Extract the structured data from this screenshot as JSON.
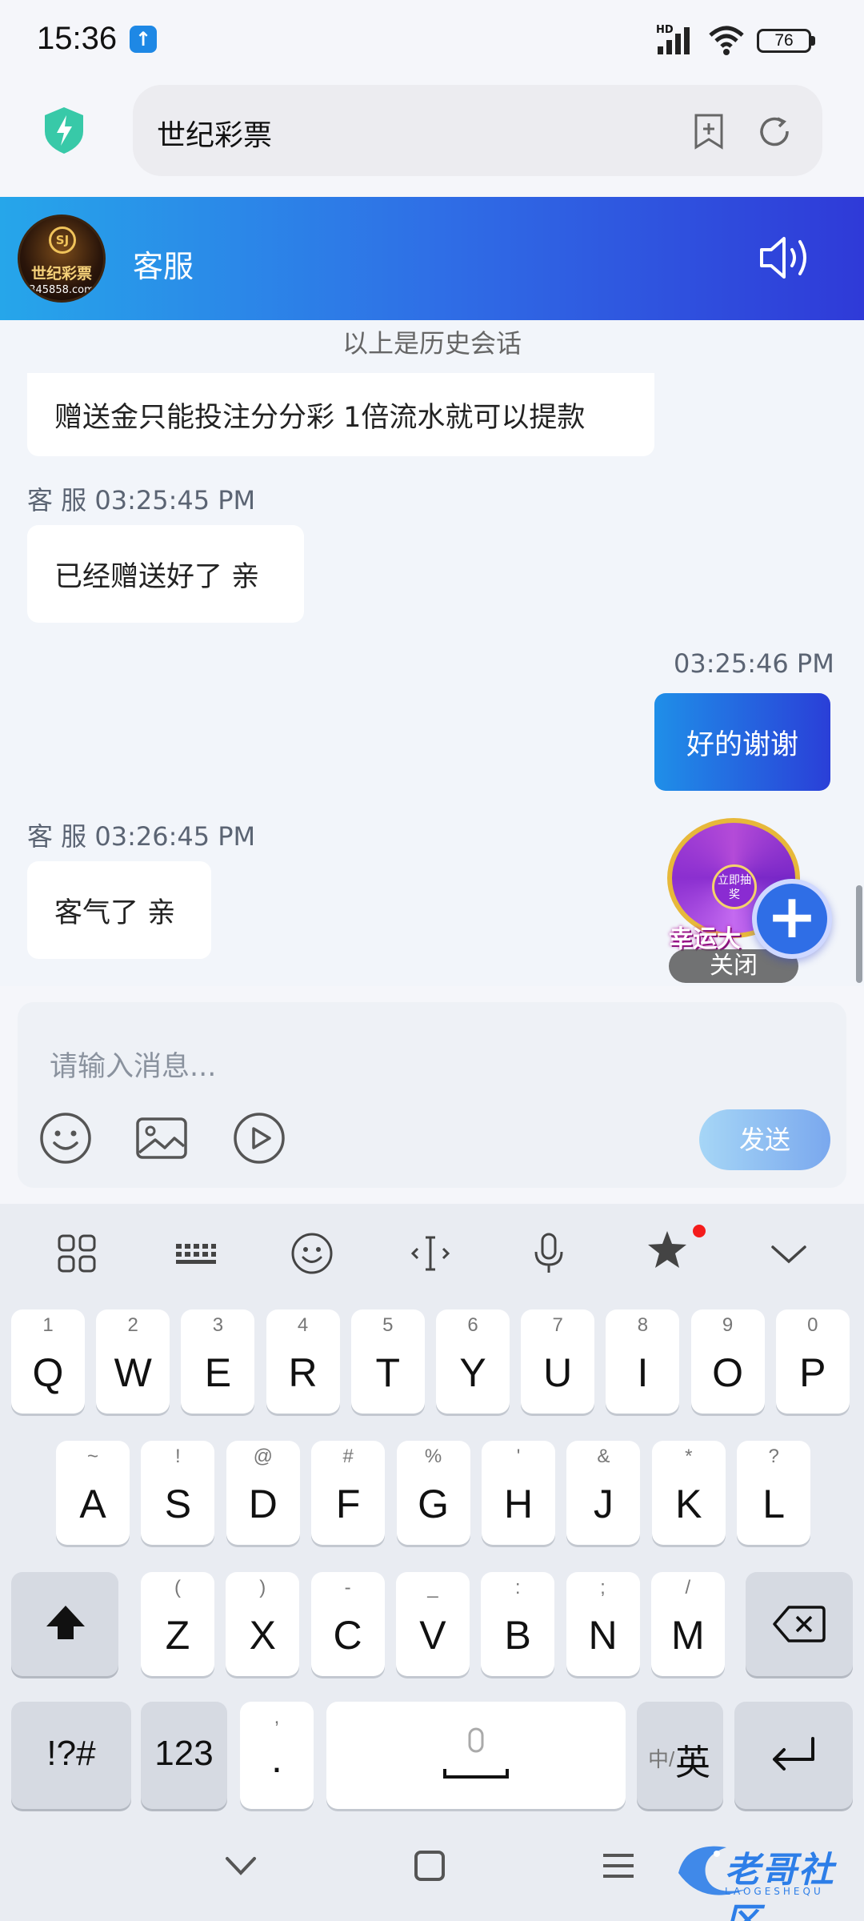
{
  "status": {
    "time": "15:36",
    "network": "HD",
    "battery": "76"
  },
  "browser": {
    "url_title": "世纪彩票"
  },
  "chat": {
    "agent_name": "客服",
    "avatar_text": "世纪彩票",
    "avatar_sub": "345858.com",
    "avatar_seal": "SJ",
    "history_notice": "以上是历史会话",
    "messages": [
      {
        "side": "left",
        "text": "赠送金只能投注分分彩 1倍流水就可以提款"
      },
      {
        "side": "left",
        "meta": "客 服 03:25:45 PM",
        "text": "已经赠送好了 亲"
      },
      {
        "side": "right",
        "meta": "03:25:46 PM",
        "text": "好的谢谢"
      },
      {
        "side": "left",
        "meta": "客 服 03:26:45 PM",
        "text": "客气了 亲"
      }
    ]
  },
  "ad": {
    "center_text": "立即抽奖",
    "title": "幸运大",
    "close_label": "关闭"
  },
  "composer": {
    "placeholder": "请输入消息...",
    "send_label": "发送"
  },
  "keyboard": {
    "row1": [
      {
        "k": "Q",
        "s": "1"
      },
      {
        "k": "W",
        "s": "2"
      },
      {
        "k": "E",
        "s": "3"
      },
      {
        "k": "R",
        "s": "4"
      },
      {
        "k": "T",
        "s": "5"
      },
      {
        "k": "Y",
        "s": "6"
      },
      {
        "k": "U",
        "s": "7"
      },
      {
        "k": "I",
        "s": "8"
      },
      {
        "k": "O",
        "s": "9"
      },
      {
        "k": "P",
        "s": "0"
      }
    ],
    "row2": [
      {
        "k": "A",
        "s": "~"
      },
      {
        "k": "S",
        "s": "!"
      },
      {
        "k": "D",
        "s": "@"
      },
      {
        "k": "F",
        "s": "#"
      },
      {
        "k": "G",
        "s": "%"
      },
      {
        "k": "H",
        "s": "'"
      },
      {
        "k": "J",
        "s": "&"
      },
      {
        "k": "K",
        "s": "*"
      },
      {
        "k": "L",
        "s": "?"
      }
    ],
    "row3": [
      {
        "k": "Z",
        "s": "("
      },
      {
        "k": "X",
        "s": ")"
      },
      {
        "k": "C",
        "s": "-"
      },
      {
        "k": "V",
        "s": "_"
      },
      {
        "k": "B",
        "s": ":"
      },
      {
        "k": "N",
        "s": ";"
      },
      {
        "k": "M",
        "s": "/"
      }
    ],
    "symbols_label": "!?#",
    "numbers_label": "123",
    "punct_label": ".",
    "punct_sub": ",",
    "lang_small": "中/",
    "lang_main": "英"
  },
  "watermark": {
    "text": "老哥社区",
    "sub": "LAOGESHEQU"
  },
  "colors": {
    "header_gradient_start": "#26a6ea",
    "header_gradient_end": "#2f3ad8",
    "send_button": "#7aa8ee",
    "fab": "#2f6ee6"
  }
}
